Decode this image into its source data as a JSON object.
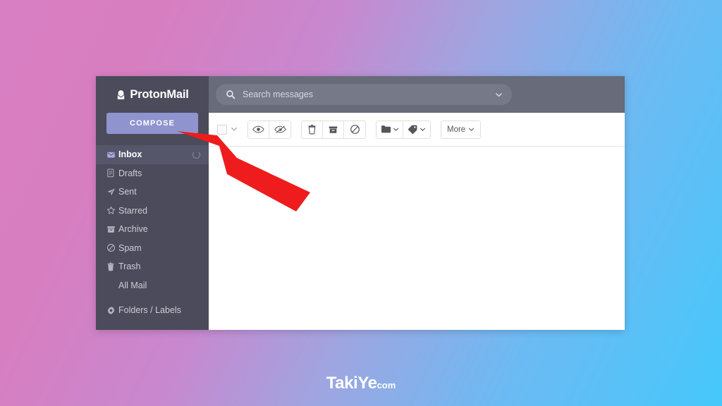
{
  "background": {
    "gradient_start": "#d87ec2",
    "gradient_end": "#45c8fb"
  },
  "app": {
    "brand": {
      "name": "ProtonMail",
      "icon": "proton-envelope-icon"
    },
    "accent_color": "#8f94ce",
    "sidebar_color": "#4b4b5b",
    "topbar_color": "#676b7a"
  },
  "sidebar": {
    "compose_label": "COMPOSE",
    "items": [
      {
        "label": "Inbox",
        "icon": "inbox-envelope-icon",
        "active": true,
        "trailing_icon": "loading-spinner-icon"
      },
      {
        "label": "Drafts",
        "icon": "draft-document-icon",
        "active": false
      },
      {
        "label": "Sent",
        "icon": "sent-paper-plane-icon",
        "active": false
      },
      {
        "label": "Starred",
        "icon": "star-outline-icon",
        "active": false
      },
      {
        "label": "Archive",
        "icon": "archive-box-icon",
        "active": false
      },
      {
        "label": "Spam",
        "icon": "spam-ban-icon",
        "active": false
      },
      {
        "label": "Trash",
        "icon": "trash-can-icon",
        "active": false
      },
      {
        "label": "All Mail",
        "icon": "none",
        "active": false
      },
      {
        "label": "Folders / Labels",
        "icon": "gear-icon",
        "active": false
      }
    ]
  },
  "search": {
    "placeholder": "Search messages",
    "value": "",
    "icon": "search-icon",
    "chevron": "chevron-down-icon"
  },
  "toolbar": {
    "select_all": {
      "name": "select-all-checkbox",
      "checked": false,
      "chevron": "chevron-down-icon"
    },
    "buttons": [
      {
        "name": "mark-as-read-button",
        "icon": "eye-icon"
      },
      {
        "name": "mark-as-unread-button",
        "icon": "eye-slash-icon"
      },
      {
        "name": "delete-button",
        "icon": "trash-can-icon"
      },
      {
        "name": "archive-button",
        "icon": "archive-box-icon"
      },
      {
        "name": "spam-button",
        "icon": "ban-circle-icon"
      },
      {
        "name": "move-to-folder-button",
        "icon": "folder-icon"
      },
      {
        "name": "label-as-button",
        "icon": "tag-icon"
      }
    ],
    "more_label": "More"
  },
  "annotation": {
    "arrow": {
      "name": "red-pointer-arrow",
      "color": "#ee1c1c",
      "points_to": "compose-button"
    }
  },
  "watermark": {
    "text": "TakiYe",
    "suffix": "com"
  }
}
